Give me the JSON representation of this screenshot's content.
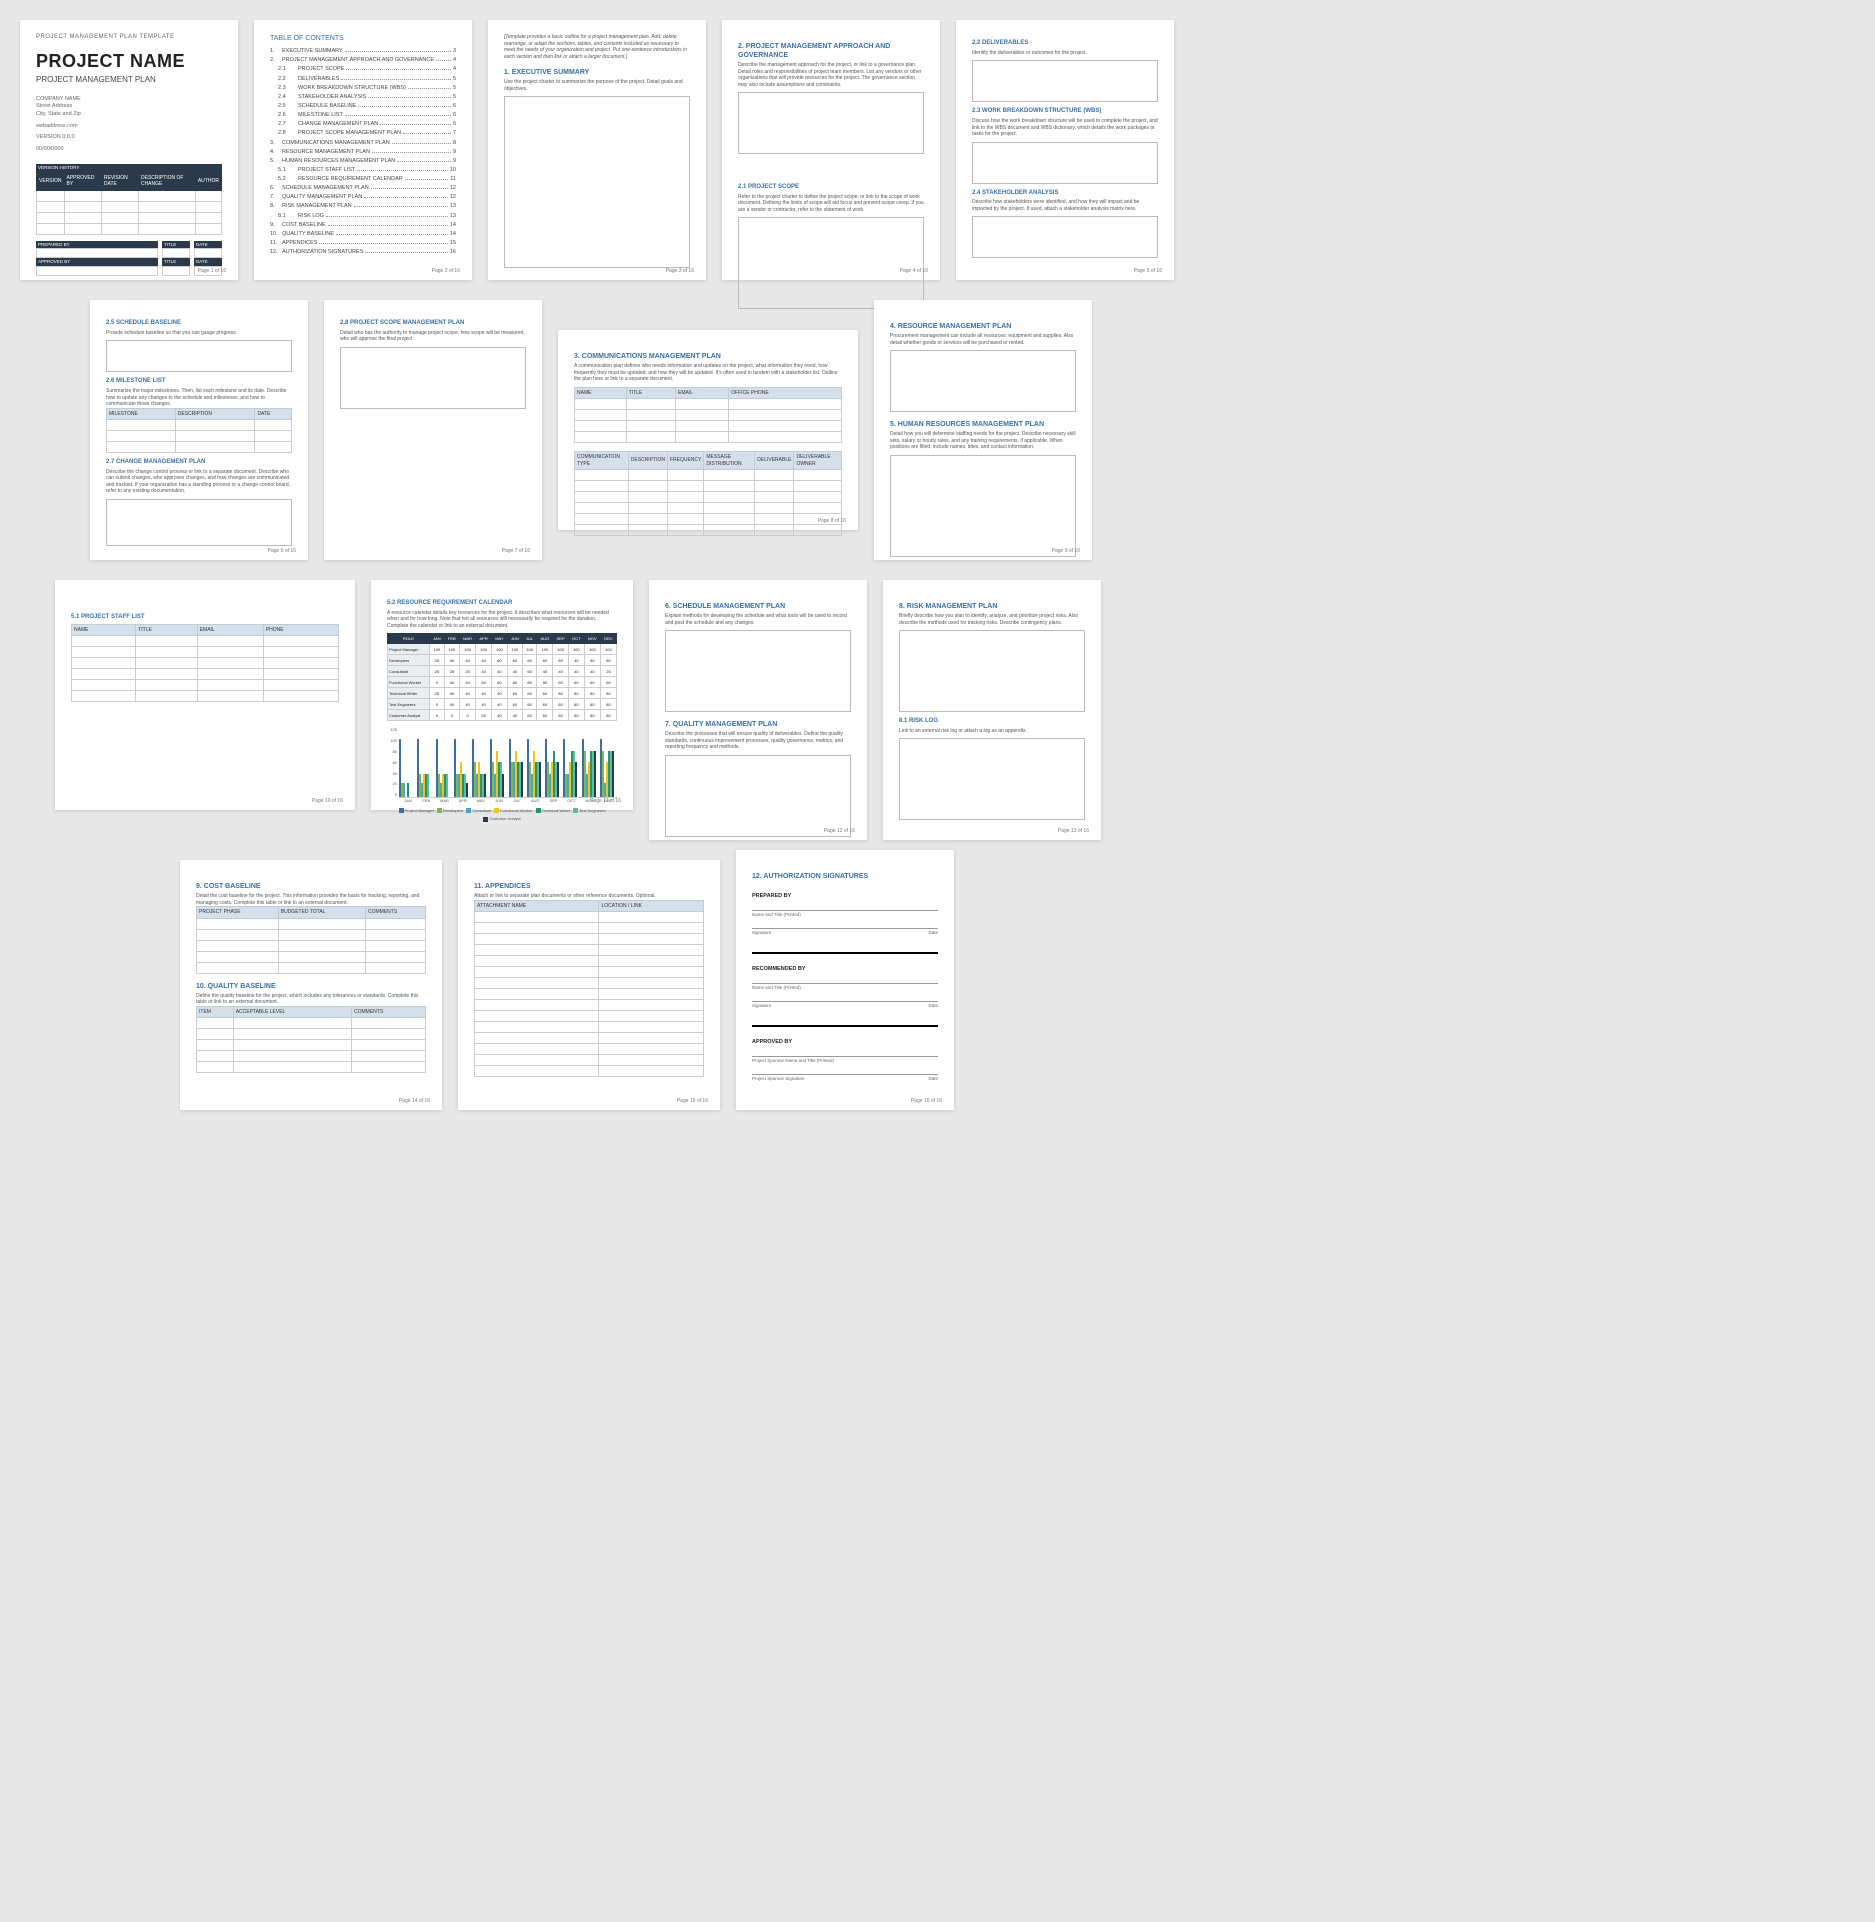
{
  "doc_tag": "PROJECT MANAGEMENT PLAN TEMPLATE",
  "title": "PROJECT NAME",
  "subtitle": "PROJECT MANAGEMENT PLAN",
  "company": {
    "name": "COMPANY NAME",
    "addr1": "Street Address",
    "addr2": "City, State and Zip",
    "web": "webaddress.com",
    "ver": "VERSION 0.0.0",
    "date": "00/00/0000"
  },
  "version_history": {
    "title": "VERSION HISTORY",
    "headers": [
      "VERSION",
      "APPROVED BY",
      "REVISION DATE",
      "DESCRIPTION OF CHANGE",
      "AUTHOR"
    ]
  },
  "approval": {
    "prepared": "PREPARED BY",
    "approved": "APPROVED BY",
    "title_lbl": "TITLE",
    "date_lbl": "DATE"
  },
  "toc": {
    "title": "TABLE OF CONTENTS",
    "items": [
      {
        "n": "1.",
        "t": "EXECUTIVE SUMMARY",
        "p": "3"
      },
      {
        "n": "2.",
        "t": "PROJECT MANAGEMENT APPROACH AND GOVERNANCE",
        "p": "4"
      },
      {
        "n": "2.1",
        "t": "PROJECT SCOPE",
        "p": "4",
        "sub": true
      },
      {
        "n": "2.2",
        "t": "DELIVERABLES",
        "p": "5",
        "sub": true
      },
      {
        "n": "2.3",
        "t": "WORK BREAKDOWN STRUCTURE (WBS)",
        "p": "5",
        "sub": true
      },
      {
        "n": "2.4",
        "t": "STAKEHOLDER ANALYSIS",
        "p": "5",
        "sub": true
      },
      {
        "n": "2.5",
        "t": "SCHEDULE BASELINE",
        "p": "6",
        "sub": true
      },
      {
        "n": "2.6",
        "t": "MILESTONE LIST",
        "p": "6",
        "sub": true
      },
      {
        "n": "2.7",
        "t": "CHANGE MANAGEMENT PLAN",
        "p": "6",
        "sub": true
      },
      {
        "n": "2.8",
        "t": "PROJECT SCOPE MANAGEMENT PLAN",
        "p": "7",
        "sub": true
      },
      {
        "n": "3.",
        "t": "COMMUNICATIONS MANAGEMENT PLAN",
        "p": "8"
      },
      {
        "n": "4.",
        "t": "RESOURCE MANAGEMENT PLAN",
        "p": "9"
      },
      {
        "n": "5.",
        "t": "HUMAN RESOURCES MANAGEMENT PLAN",
        "p": "9"
      },
      {
        "n": "5.1",
        "t": "PROJECT STAFF LIST",
        "p": "10",
        "sub": true
      },
      {
        "n": "5.2",
        "t": "RESOURCE REQUIREMENT CALENDAR",
        "p": "11",
        "sub": true
      },
      {
        "n": "6.",
        "t": "SCHEDULE MANAGEMENT PLAN",
        "p": "12"
      },
      {
        "n": "7.",
        "t": "QUALITY MANAGEMENT PLAN",
        "p": "12"
      },
      {
        "n": "8.",
        "t": "RISK MANAGEMENT PLAN",
        "p": "13"
      },
      {
        "n": "8.1",
        "t": "RISK LOG",
        "p": "13",
        "sub": true
      },
      {
        "n": "9.",
        "t": "COST BASELINE",
        "p": "14"
      },
      {
        "n": "10.",
        "t": "QUALITY BASELINE",
        "p": "14"
      },
      {
        "n": "11.",
        "t": "APPENDICES",
        "p": "15"
      },
      {
        "n": "12.",
        "t": "AUTHORIZATION SIGNATURES",
        "p": "16"
      }
    ]
  },
  "pages": {
    "p3_intro": "[Template provides a basic outline for a project management plan. Add, delete, rearrange, or adapt the sections, tables, and contents included as necessary to meet the needs of your organization and project. Put one-sentence introductions in each section and then link or attach a larger document.]",
    "p3_h": "1. EXECUTIVE SUMMARY",
    "p3_b": "Use the project charter to summarize the purpose of the project. Detail goals and objectives.",
    "p4_h": "2. PROJECT MANAGEMENT APPROACH AND GOVERNANCE",
    "p4_b": "Describe the management approach for the project, or link to a governance plan. Detail roles and responsibilities of project team members. List any vendors or other organizations that will provide resources for the project. The governance section may also include assumptions and constraints.",
    "p4_sh": "2.1    PROJECT SCOPE",
    "p4_sb": "Refer to the project charter to define the project scope, or link to the scope of work document. Defining the limits of scope will aid focus and prevent scope creep. If you are a vendor or contractor, refer to the statement of work.",
    "p5_a_h": "2.2    DELIVERABLES",
    "p5_a_b": "Identify the deliverables or outcomes for the project.",
    "p5_b_h": "2.3    WORK BREAKDOWN STRUCTURE (WBS)",
    "p5_b_b": "Discuss how the work breakdown structure will be used to complete the project, and link to the WBS document and WBS dictionary, which details the work packages or tasks for the project.",
    "p5_c_h": "2.4    STAKEHOLDER ANALYSIS",
    "p5_c_b": "Describe how stakeholders were identified, and how they will impact and be impacted by the project. If used, attach a stakeholder analysis matrix here.",
    "p6_a_h": "2.5    SCHEDULE BASELINE",
    "p6_a_b": "Provide schedule baseline so that you can gauge progress.",
    "p6_b_h": "2.6    MILESTONE LIST",
    "p6_b_b": "Summarize the major milestones. Then, list each milestone and its date. Describe how to update any changes to the schedule and milestones, and how to communicate those changes.",
    "p6_tbl": [
      "MILESTONE",
      "DESCRIPTION",
      "DATE"
    ],
    "p6_c_h": "2.7    CHANGE MANAGEMENT PLAN",
    "p6_c_b": "Describe the change control process or link to a separate document. Describe who can submit changes, who approves changes, and how changes are communicated and tracked. If your organization has a standing process or a change control board, refer to any existing documentation.",
    "p7_h": "2.8    PROJECT SCOPE MANAGEMENT PLAN",
    "p7_b": "Detail who has the authority to manage project scope, how scope will be measured, who will approve the final project.",
    "p8_h": "3. COMMUNICATIONS MANAGEMENT PLAN",
    "p8_b": "A communication plan defines who needs information and updates on the project, what information they need, how frequently they must be updated, and how they will be updated. It's often used in tandem with a stakeholder list. Outline the plan here or link to a separate document.",
    "p8_t1": [
      "NAME",
      "TITLE",
      "EMAIL",
      "OFFICE PHONE"
    ],
    "p8_t2": [
      "COMMUNICATION TYPE",
      "DESCRIPTION",
      "FREQUENCY",
      "MESSAGE DISTRIBUTION",
      "DELIVERABLE",
      "DELIVERABLE OWNER"
    ],
    "p9_a_h": "4. RESOURCE MANAGEMENT PLAN",
    "p9_a_b": "Procurement management can include all resources: equipment and supplies. Also detail whether goods or services will be purchased or rented.",
    "p9_b_h": "5. HUMAN RESOURCES MANAGEMENT PLAN",
    "p9_b_b": "Detail how you will determine staffing needs for the project. Describe necessary skill sets, salary or hourly rates, and any training requirements, if applicable. When positions are filled, include names, titles, and contact information.",
    "p10_h": "5.1    PROJECT STAFF LIST",
    "p10_tbl": [
      "NAME",
      "TITLE",
      "EMAIL",
      "PHONE"
    ],
    "p11_h": "5.2    RESOURCE REQUIREMENT CALENDAR",
    "p11_b": "A resource calendar details key resources for the project. It describes what resources will be needed when and for how long. Note that not all resources will necessarily be required for the duration. Complete the calendar or link to an external document.",
    "p12_a_h": "6. SCHEDULE MANAGEMENT PLAN",
    "p12_a_b": "Explain methods for developing the schedule and what tools will be used to record and post the schedule and any changes.",
    "p12_b_h": "7. QUALITY MANAGEMENT PLAN",
    "p12_b_b": "Describe the processes that will ensure quality of deliverables. Define the quality standards, continuous improvement processes, quality governance, metrics, and reporting frequency and methods.",
    "p13_a_h": "8. RISK MANAGEMENT PLAN",
    "p13_a_b": "Briefly describe how you plan to identify, analyze, and prioritize project risks. Also describe the methods used for tracking risks. Describe contingency plans.",
    "p13_b_h": "8.1    RISK LOG",
    "p13_b_b": "Link to an external risk log or attach a log as an appendix.",
    "p14_a_h": "9. COST BASELINE",
    "p14_a_b": "Detail the cost baseline for the project. This information provides the basis for tracking, reporting, and managing costs. Complete this table or link to an external document.",
    "p14_a_tbl": [
      "PROJECT PHASE",
      "BUDGETED TOTAL",
      "COMMENTS"
    ],
    "p14_b_h": "10. QUALITY BASELINE",
    "p14_b_b": "Define the quality baseline for the project, which includes any tolerances or standards. Complete this table or link to an external document.",
    "p14_b_tbl": [
      "ITEM",
      "ACCEPTABLE LEVEL",
      "COMMENTS"
    ],
    "p15_h": "11. APPENDICES",
    "p15_b": "Attach or link to separate plan documents or other reference documents. Optional.",
    "p15_tbl": [
      "ATTACHMENT NAME",
      "LOCATION / LINK"
    ],
    "p16_h": "12. AUTHORIZATION SIGNATURES",
    "p16": {
      "prepared": "PREPARED BY",
      "recommended": "RECOMMENDED BY",
      "approved": "APPROVED BY",
      "name_printed": "Name and Title  (Printed)",
      "sponsor_printed": "Project Sponsor Name and Title  (Printed)",
      "sig": "Signature",
      "sponsor_sig": "Project Sponsor Signature",
      "date": "Date"
    }
  },
  "footer": {
    "p": "Page ",
    "of": " of 16"
  },
  "chart_data": {
    "type": "bar",
    "table": {
      "headers": [
        "ROLE",
        "JAN",
        "FEB",
        "MAR",
        "APR",
        "MAY",
        "JUN",
        "JUL",
        "AUG",
        "SEP",
        "OCT",
        "NOV",
        "DEC"
      ],
      "rows": [
        {
          "name": "Project Manager",
          "v": [
            100,
            100,
            100,
            100,
            100,
            100,
            100,
            100,
            100,
            100,
            100,
            100
          ]
        },
        {
          "name": "Developers",
          "v": [
            25,
            40,
            40,
            40,
            60,
            60,
            60,
            60,
            60,
            40,
            80,
            80
          ]
        },
        {
          "name": "Consultant",
          "v": [
            25,
            25,
            25,
            40,
            40,
            40,
            60,
            40,
            40,
            40,
            40,
            25
          ]
        },
        {
          "name": "Functional Worker",
          "v": [
            0,
            40,
            40,
            60,
            60,
            80,
            80,
            80,
            60,
            60,
            60,
            60
          ]
        },
        {
          "name": "Technical Writer",
          "v": [
            25,
            40,
            40,
            40,
            40,
            60,
            60,
            60,
            80,
            80,
            80,
            80
          ]
        },
        {
          "name": "Test Engineers",
          "v": [
            0,
            40,
            40,
            40,
            40,
            60,
            60,
            60,
            60,
            80,
            80,
            80
          ]
        },
        {
          "name": "Customer Analyst",
          "v": [
            0,
            0,
            0,
            25,
            40,
            40,
            60,
            60,
            60,
            60,
            80,
            80
          ]
        }
      ]
    },
    "categories": [
      "JAN",
      "FEB",
      "MAR",
      "APR",
      "MAY",
      "JUN",
      "JUL",
      "AUG",
      "SEP",
      "OCT",
      "NOV",
      "DEC"
    ],
    "series": [
      {
        "name": "Project Manager",
        "color": "#3b6fa0",
        "values": [
          100,
          100,
          100,
          100,
          100,
          100,
          100,
          100,
          100,
          100,
          100,
          100
        ]
      },
      {
        "name": "Developers",
        "color": "#7fb84f",
        "values": [
          25,
          40,
          40,
          40,
          60,
          60,
          60,
          60,
          60,
          40,
          80,
          80
        ]
      },
      {
        "name": "Consultant",
        "color": "#4aa6c2",
        "values": [
          25,
          25,
          25,
          40,
          40,
          40,
          60,
          40,
          40,
          40,
          40,
          25
        ]
      },
      {
        "name": "Functional Worker",
        "color": "#f0c419",
        "values": [
          0,
          40,
          40,
          60,
          60,
          80,
          80,
          80,
          60,
          60,
          60,
          60
        ]
      },
      {
        "name": "Technical Writer",
        "color": "#2c8f6f",
        "values": [
          25,
          40,
          40,
          40,
          40,
          60,
          60,
          60,
          80,
          80,
          80,
          80
        ]
      },
      {
        "name": "Test Engineers",
        "color": "#5bbf9b",
        "values": [
          0,
          40,
          40,
          40,
          40,
          60,
          60,
          60,
          60,
          80,
          80,
          80
        ]
      },
      {
        "name": "Customer Analyst",
        "color": "#2b3a4a",
        "values": [
          0,
          0,
          0,
          25,
          40,
          40,
          60,
          60,
          60,
          60,
          80,
          80
        ]
      }
    ],
    "ylim": [
      0,
      120
    ],
    "yticks": [
      0,
      20,
      40,
      60,
      80,
      100,
      120
    ],
    "title": "",
    "ylabel": "",
    "xlabel": ""
  }
}
